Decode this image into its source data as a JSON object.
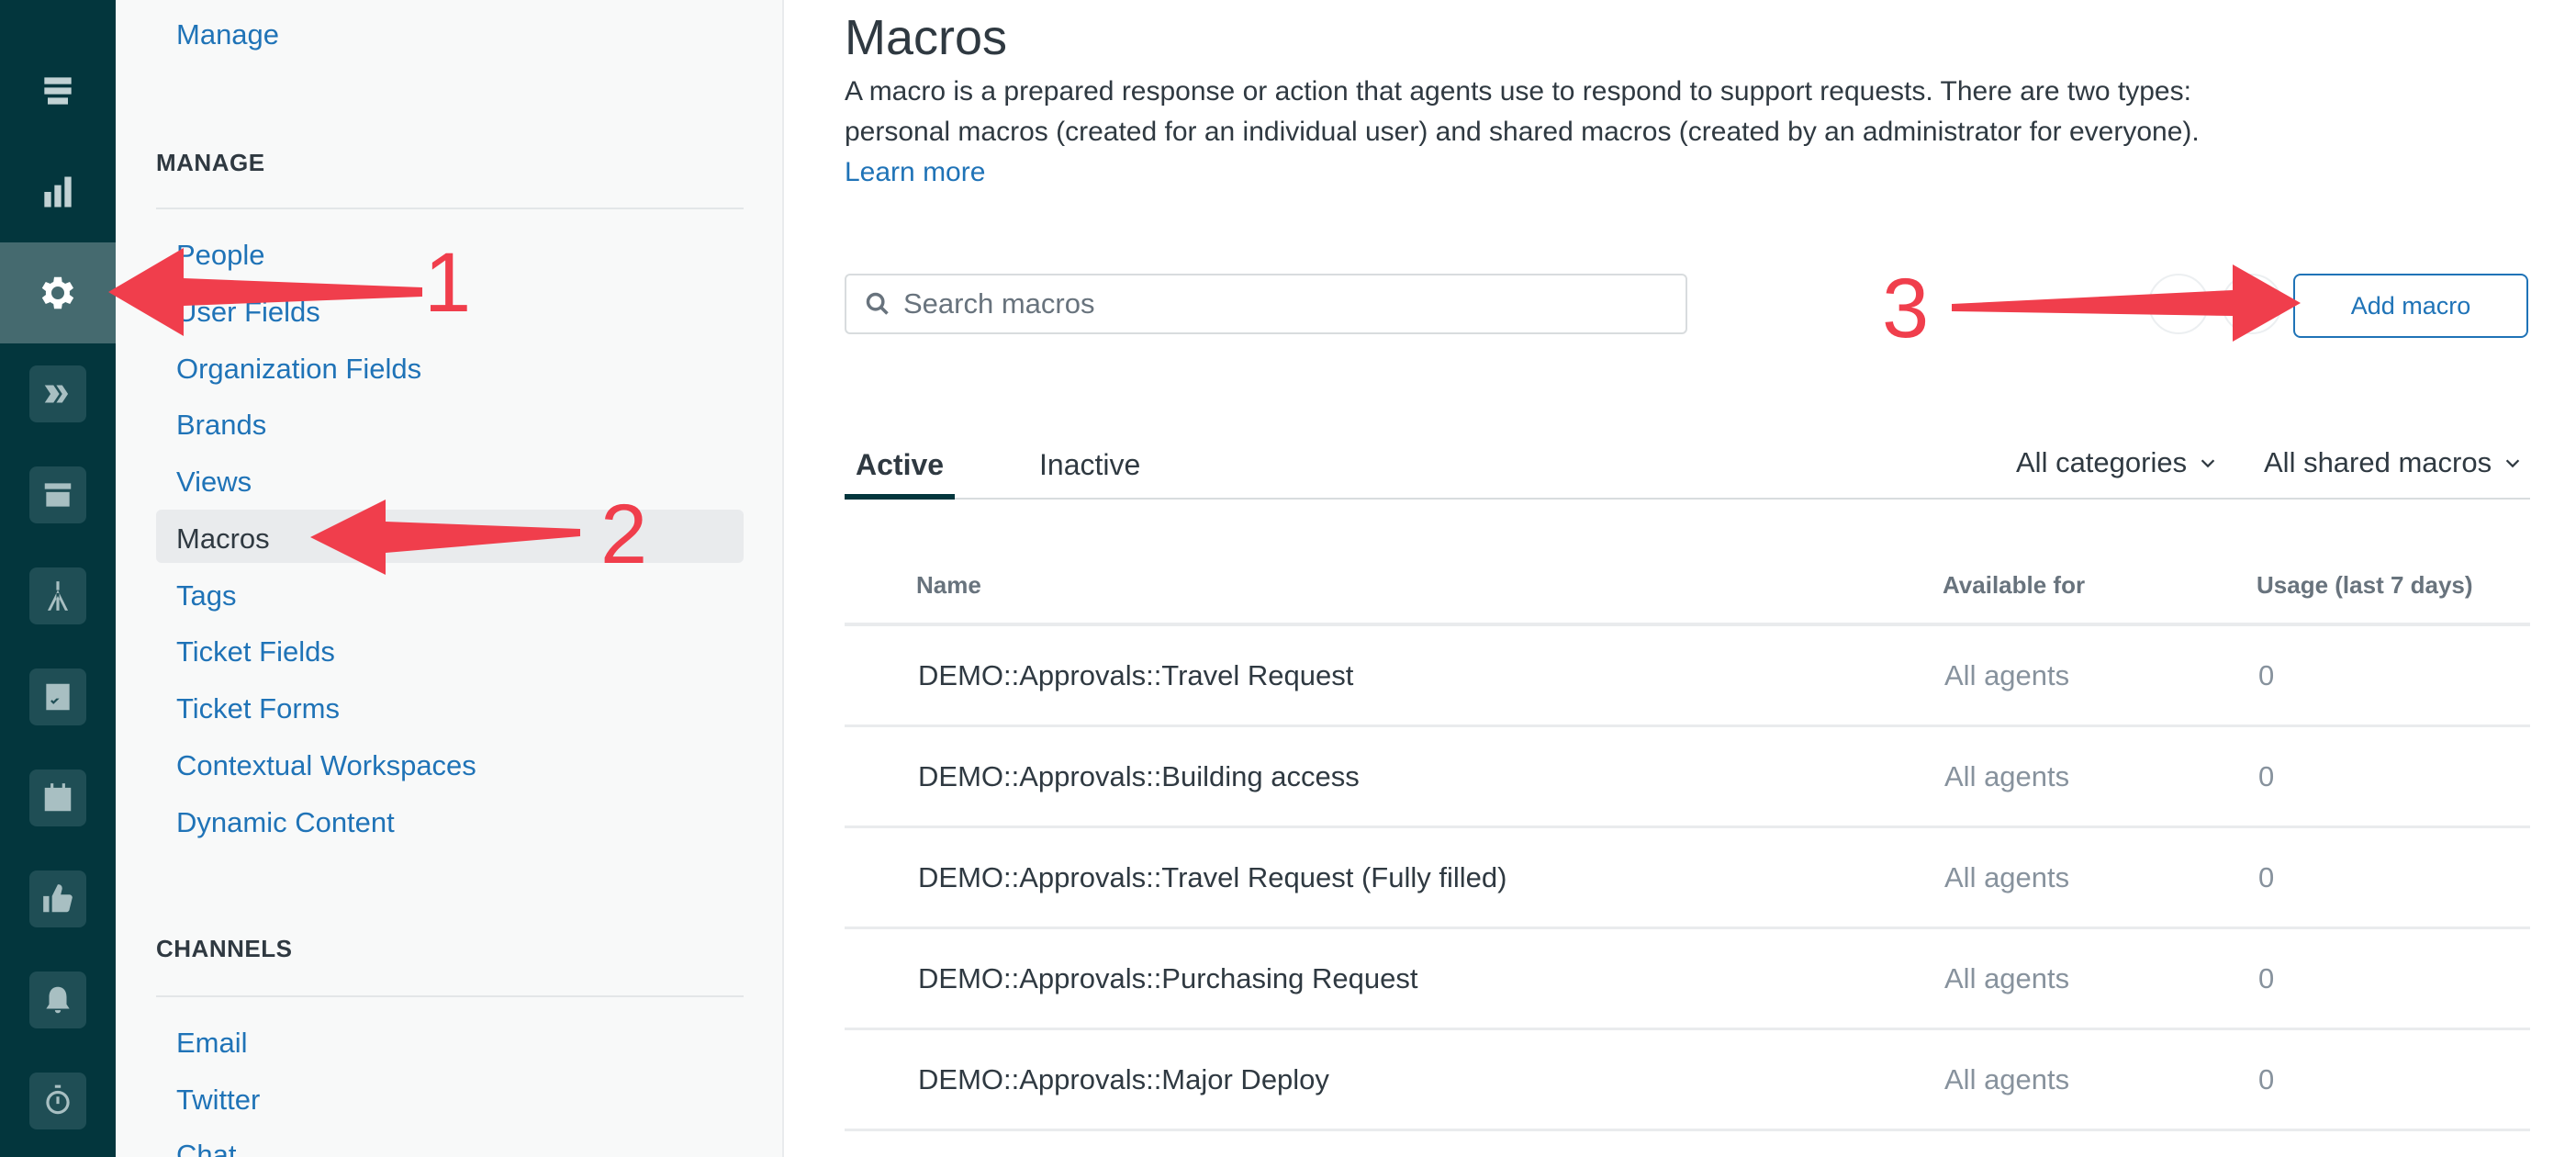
{
  "rail": {
    "items": [
      {
        "icon": "home-icon"
      },
      {
        "icon": "tickets-icon"
      },
      {
        "icon": "reporting-icon"
      },
      {
        "icon": "gear-icon",
        "active": true
      },
      {
        "icon": "channels-icon"
      },
      {
        "icon": "shop-icon"
      },
      {
        "icon": "tripod-icon"
      },
      {
        "icon": "checklist-icon"
      },
      {
        "icon": "calendar-icon"
      },
      {
        "icon": "thumbs-up-icon"
      },
      {
        "icon": "bell-icon"
      },
      {
        "icon": "stopwatch-icon"
      }
    ]
  },
  "sidebar": {
    "top_link": "Manage",
    "manage_section": {
      "heading": "MANAGE",
      "items": [
        "People",
        "User Fields",
        "Organization Fields",
        "Brands",
        "Views",
        "Macros",
        "Tags",
        "Ticket Fields",
        "Ticket Forms",
        "Contextual Workspaces",
        "Dynamic Content"
      ],
      "selected": "Macros"
    },
    "channels_section": {
      "heading": "CHANNELS",
      "items": [
        "Email",
        "Twitter",
        "Chat"
      ]
    }
  },
  "main": {
    "title": "Macros",
    "description": "A macro is a prepared response or action that agents use to respond to support requests. There are two types: personal macros (created for an individual user) and shared macros (created by an administrator for everyone).",
    "learn_more": "Learn more",
    "search": {
      "placeholder": "Search macros",
      "value": ""
    },
    "add_button": "Add macro",
    "tabs": [
      {
        "label": "Active",
        "active": true
      },
      {
        "label": "Inactive",
        "active": false
      }
    ],
    "filters": {
      "categories": "All categories",
      "shared": "All shared macros"
    },
    "table": {
      "headers": {
        "name": "Name",
        "available": "Available for",
        "usage": "Usage (last 7 days)"
      },
      "rows": [
        {
          "name": "DEMO::Approvals::Travel Request",
          "available": "All agents",
          "usage": "0"
        },
        {
          "name": "DEMO::Approvals::Building access",
          "available": "All agents",
          "usage": "0"
        },
        {
          "name": "DEMO::Approvals::Travel Request (Fully filled)",
          "available": "All agents",
          "usage": "0"
        },
        {
          "name": "DEMO::Approvals::Purchasing Request",
          "available": "All agents",
          "usage": "0"
        },
        {
          "name": "DEMO::Approvals::Major Deploy",
          "available": "All agents",
          "usage": "0"
        }
      ]
    }
  },
  "annotations": {
    "step1": "1",
    "step2": "2",
    "step3": "3",
    "color": "#f03e4c"
  },
  "colors": {
    "rail_bg": "#03363d",
    "link": "#1f73b7",
    "text": "#2f3941"
  }
}
